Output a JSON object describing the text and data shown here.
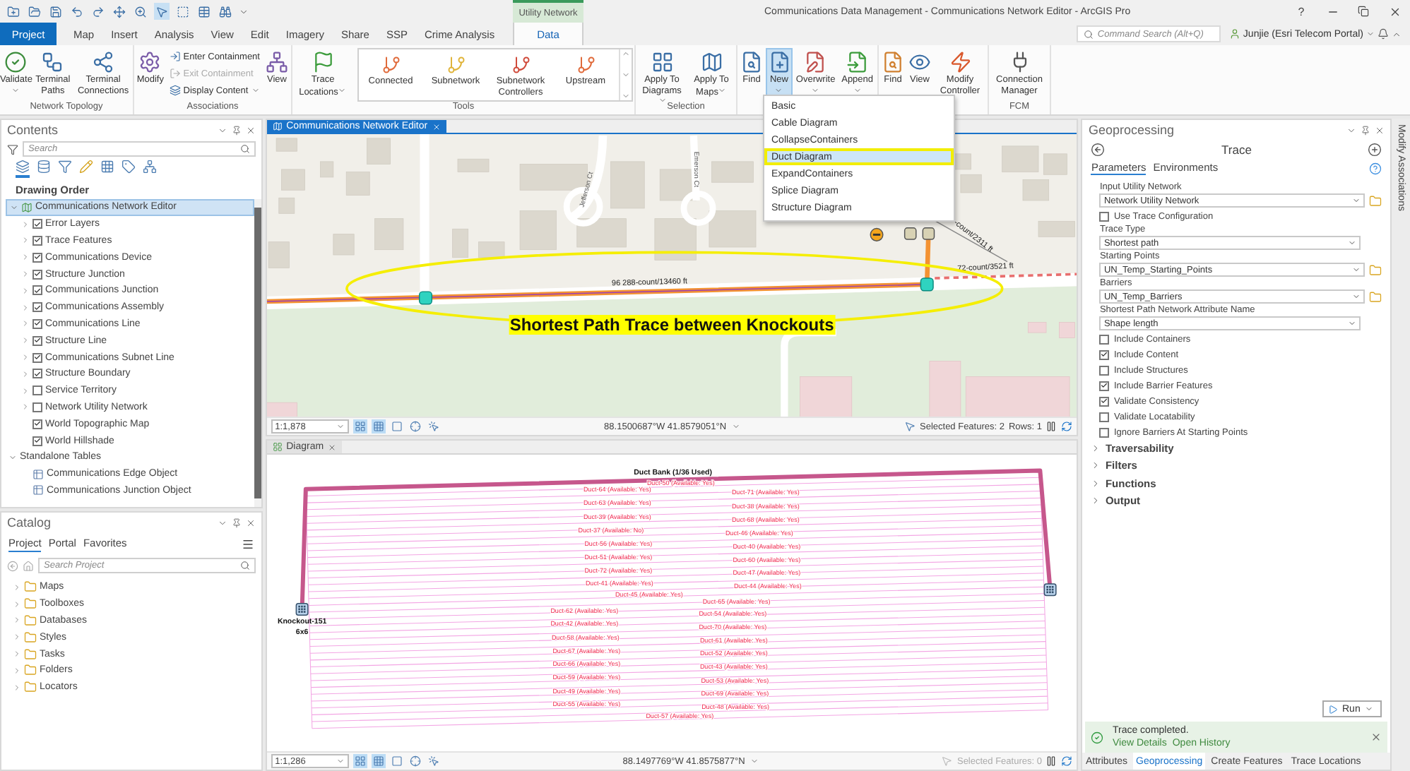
{
  "title_bar": {
    "title": "Communications Data Management - Communications Network Editor - ArcGIS Pro",
    "contextual_group": "Utility Network",
    "help": "?"
  },
  "quick_access": [
    {
      "on": false
    },
    {
      "on": false
    },
    {
      "on": false
    },
    {
      "on": false
    },
    {
      "on": false
    },
    {
      "on": false
    },
    {
      "on": false
    },
    {
      "on": true
    },
    {
      "on": false
    },
    {
      "on": false
    },
    {
      "on": false
    }
  ],
  "ribbon_tabs": [
    {
      "label": "Project",
      "kind": "backstage",
      "selected": false
    },
    {
      "label": "Map",
      "kind": "tab",
      "selected": false
    },
    {
      "label": "Insert",
      "kind": "tab",
      "selected": false
    },
    {
      "label": "Analysis",
      "kind": "tab",
      "selected": false
    },
    {
      "label": "View",
      "kind": "tab",
      "selected": false
    },
    {
      "label": "Edit",
      "kind": "tab",
      "selected": false
    },
    {
      "label": "Imagery",
      "kind": "tab",
      "selected": false
    },
    {
      "label": "Share",
      "kind": "tab",
      "selected": false
    },
    {
      "label": "SSP",
      "kind": "tab",
      "selected": false
    },
    {
      "label": "Crime Analysis",
      "kind": "tab",
      "selected": false
    },
    {
      "label": "Data",
      "kind": "contextual",
      "selected": true
    }
  ],
  "command_search": {
    "placeholder": "Command Search (Alt+Q)"
  },
  "user": {
    "name": "Junjie (Esri Telecom Portal)"
  },
  "ribbon_groups": [
    {
      "label": "Network Topology",
      "kind": "buttons",
      "buttons": [
        {
          "label": "Validate",
          "kind": "large",
          "dropdown": true,
          "disabled": false,
          "pressed": false
        },
        {
          "label": "Terminal Paths",
          "kind": "large",
          "dropdown": false,
          "disabled": false,
          "pressed": false
        },
        {
          "label": "Terminal Connections",
          "kind": "large",
          "dropdown": false,
          "disabled": false,
          "pressed": false
        }
      ]
    },
    {
      "label": "Associations",
      "kind": "buttons",
      "buttons": [
        {
          "label": "Modify",
          "kind": "large",
          "dropdown": false,
          "disabled": false,
          "pressed": false
        },
        {
          "label": "Enter Containment",
          "kind": "small",
          "dropdown": false,
          "disabled": false,
          "pressed": false
        },
        {
          "label": "Exit Containment",
          "kind": "small",
          "dropdown": false,
          "disabled": true,
          "pressed": false
        },
        {
          "label": "Display Content",
          "kind": "small",
          "dropdown": true,
          "disabled": false,
          "pressed": false
        },
        {
          "label": "View",
          "kind": "large",
          "dropdown": false,
          "disabled": false,
          "pressed": false
        }
      ]
    },
    {
      "label": "Tools",
      "kind": "gallery",
      "buttons": [
        {
          "label": "Trace Locations",
          "kind": "large",
          "dropdown": true,
          "disabled": false,
          "pressed": false
        }
      ],
      "gallery": [
        {
          "label": "Connected"
        },
        {
          "label": "Subnetwork"
        },
        {
          "label": "Subnetwork Controllers"
        },
        {
          "label": "Upstream"
        }
      ]
    },
    {
      "label": "Selection",
      "kind": "buttons",
      "buttons": [
        {
          "label": "Apply To Diagrams",
          "kind": "large",
          "dropdown": true,
          "disabled": false,
          "pressed": false
        },
        {
          "label": "Apply To Maps",
          "kind": "large",
          "dropdown": true,
          "disabled": false,
          "pressed": false
        }
      ]
    },
    {
      "kind": "buttons",
      "buttons": [
        {
          "label": "Find",
          "kind": "large",
          "dropdown": false,
          "disabled": false,
          "pressed": false
        },
        {
          "label": "New",
          "kind": "large",
          "dropdown": true,
          "disabled": false,
          "pressed": true
        },
        {
          "label": "Overwrite",
          "kind": "large",
          "dropdown": true,
          "disabled": false,
          "pressed": false
        },
        {
          "label": "Append",
          "kind": "large",
          "dropdown": true,
          "disabled": false,
          "pressed": false
        }
      ]
    },
    {
      "kind": "buttons",
      "buttons": [
        {
          "label": "Find",
          "kind": "large",
          "dropdown": false,
          "disabled": false,
          "pressed": false
        },
        {
          "label": "View",
          "kind": "large",
          "dropdown": false,
          "disabled": false,
          "pressed": false
        },
        {
          "label": "Modify Controller",
          "kind": "large",
          "dropdown": false,
          "disabled": false,
          "pressed": false
        }
      ]
    },
    {
      "label": "FCM",
      "kind": "buttons",
      "buttons": [
        {
          "label": "Connection Manager",
          "kind": "large",
          "dropdown": false,
          "disabled": false,
          "pressed": false
        }
      ]
    }
  ],
  "new_menu": {
    "items": [
      {
        "label": "Basic",
        "selected": false
      },
      {
        "label": "Cable Diagram",
        "selected": false
      },
      {
        "label": "CollapseContainers",
        "selected": false
      },
      {
        "label": "Duct Diagram",
        "selected": true
      },
      {
        "label": "ExpandContainers",
        "selected": false
      },
      {
        "label": "Splice Diagram",
        "selected": false
      },
      {
        "label": "Structure Diagram",
        "selected": false
      }
    ]
  },
  "contents": {
    "title": "Contents",
    "search_placeholder": "Search",
    "view_buttons": [
      {
        "selected": true
      },
      {
        "selected": false
      },
      {
        "selected": false
      },
      {
        "selected": false
      },
      {
        "selected": false
      },
      {
        "selected": false
      },
      {
        "selected": false
      }
    ],
    "heading": "Drawing Order",
    "tree": [
      {
        "label": "Communications Network Editor",
        "kind": "map",
        "selected": true,
        "expanded": true,
        "children": [
          {
            "label": "Error Layers",
            "kind": "layer",
            "selected": false,
            "expandable": true,
            "checked": true
          },
          {
            "label": "Trace Features",
            "kind": "layer",
            "selected": false,
            "expandable": true,
            "checked": true
          },
          {
            "label": "Communications Device",
            "kind": "layer",
            "selected": false,
            "expandable": true,
            "checked": true
          },
          {
            "label": "Structure Junction",
            "kind": "layer",
            "selected": false,
            "expandable": true,
            "checked": true
          },
          {
            "label": "Communications Junction",
            "kind": "layer",
            "selected": false,
            "expandable": true,
            "checked": true
          },
          {
            "label": "Communications Assembly",
            "kind": "layer",
            "selected": false,
            "expandable": true,
            "checked": true
          },
          {
            "label": "Communications Line",
            "kind": "layer",
            "selected": false,
            "expandable": true,
            "checked": true
          },
          {
            "label": "Structure Line",
            "kind": "layer",
            "selected": false,
            "expandable": true,
            "checked": true
          },
          {
            "label": "Communications Subnet Line",
            "kind": "layer",
            "selected": false,
            "expandable": true,
            "checked": true
          },
          {
            "label": "Structure Boundary",
            "kind": "layer",
            "selected": false,
            "expandable": true,
            "checked": true
          },
          {
            "label": "Service Territory",
            "kind": "layer",
            "selected": false,
            "expandable": true,
            "checked": false
          },
          {
            "label": "Network Utility Network",
            "kind": "layer",
            "selected": false,
            "expandable": true,
            "checked": false
          },
          {
            "label": "World Topographic Map",
            "kind": "layer",
            "selected": false,
            "expandable": false,
            "checked": true
          },
          {
            "label": "World Hillshade",
            "kind": "layer",
            "selected": false,
            "expandable": false,
            "checked": true
          }
        ]
      },
      {
        "label": "Standalone Tables",
        "kind": "group",
        "selected": false,
        "expanded": true,
        "children": [
          {
            "label": "Communications Edge Object",
            "kind": "table",
            "selected": false
          },
          {
            "label": "Communications Junction Object",
            "kind": "table",
            "selected": false
          }
        ]
      }
    ]
  },
  "catalog": {
    "title": "Catalog",
    "tabs": [
      {
        "label": "Project",
        "selected": true
      },
      {
        "label": "Portal",
        "selected": false
      },
      {
        "label": "Favorites",
        "selected": false
      }
    ],
    "search_placeholder": "Search Project",
    "items": [
      {
        "label": "Maps"
      },
      {
        "label": "Toolboxes"
      },
      {
        "label": "Databases"
      },
      {
        "label": "Styles"
      },
      {
        "label": "Tasks"
      },
      {
        "label": "Folders"
      },
      {
        "label": "Locators"
      }
    ]
  },
  "map_view": {
    "tab": {
      "label": "Communications Network Editor",
      "selected": true
    },
    "street_labels": [
      "Jefferson Ct",
      "Emerson Ct"
    ],
    "line_labels": [
      "96 288-count/13460 ft",
      "-count/2311 ft",
      "72-count/3521 ft"
    ],
    "annotation": "Shortest Path Trace between Knockouts",
    "status": {
      "scale": "1:1,878",
      "toggles": [
        {
          "on": true
        },
        {
          "on": true
        },
        {
          "on": false
        },
        {
          "on": false
        },
        {
          "on": false
        }
      ],
      "coordinates": "88.1500687°W 41.8579051°N",
      "selected_features": {
        "text": "Selected Features: 2",
        "disabled": false
      },
      "rows": "Rows: 1"
    }
  },
  "diagram_view": {
    "tab": {
      "label": "Diagram",
      "selected": false
    },
    "title": "Duct Bank (1/36 Used)",
    "knockout": {
      "name": "Knockout-151",
      "size": "6x6"
    },
    "ducts": [
      "Duct-50 (Available: Yes)",
      "Duct-64 (Available: Yes)",
      "Duct-63 (Available: Yes)",
      "Duct-39 (Available: Yes)",
      "Duct-37 (Available: No)",
      "Duct-56 (Available: Yes)",
      "Duct-51 (Available: Yes)",
      "Duct-72 (Available: Yes)",
      "Duct-41 (Available: Yes)",
      "Duct-71 (Available: Yes)",
      "Duct-38 (Available: Yes)",
      "Duct-68 (Available: Yes)",
      "Duct-46 (Available: Yes)",
      "Duct-40 (Available: Yes)",
      "Duct-60 (Available: Yes)",
      "Duct-47 (Available: Yes)",
      "Duct-44 (Available: Yes)",
      "Duct-45 (Available: Yes)",
      "Duct-65 (Available: Yes)",
      "Duct-54 (Available: Yes)",
      "Duct-70 (Available: Yes)",
      "Duct-61 (Available: Yes)",
      "Duct-52 (Available: Yes)",
      "Duct-43 (Available: Yes)",
      "Duct-53 (Available: Yes)",
      "Duct-69 (Available: Yes)",
      "Duct-48 (Available: Yes)",
      "Duct-62 (Available: Yes)",
      "Duct-42 (Available: Yes)",
      "Duct-58 (Available: Yes)",
      "Duct-67 (Available: Yes)",
      "Duct-66 (Available: Yes)",
      "Duct-59 (Available: Yes)",
      "Duct-49 (Available: Yes)",
      "Duct-55 (Available: Yes)",
      "Duct-57 (Available: Yes)"
    ],
    "status": {
      "scale": "1:1,286",
      "toggles": [
        {
          "on": true
        },
        {
          "on": true
        },
        {
          "on": false
        },
        {
          "on": false
        },
        {
          "on": false
        }
      ],
      "coordinates": "88.1497769°W 41.8575877°N",
      "selected_features": {
        "text": "Selected Features: 0",
        "disabled": true
      }
    }
  },
  "geoprocessing": {
    "title": "Geoprocessing",
    "tool": "Trace",
    "tabs": [
      {
        "label": "Parameters",
        "selected": true
      },
      {
        "label": "Environments",
        "selected": false
      }
    ],
    "params": [
      {
        "kind": "select",
        "label": "Input Utility Network",
        "value": "Network Utility Network",
        "browse": true
      },
      {
        "kind": "checkbox",
        "label": "Use Trace Configuration",
        "checked": false
      },
      {
        "kind": "select",
        "label": "Trace Type",
        "value": "Shortest path",
        "browse": false
      },
      {
        "kind": "select",
        "label": "Starting Points",
        "value": "UN_Temp_Starting_Points",
        "browse": true
      },
      {
        "kind": "select",
        "label": "Barriers",
        "value": "UN_Temp_Barriers",
        "browse": true
      },
      {
        "kind": "select",
        "label": "Shortest Path Network Attribute Name",
        "value": "Shape length",
        "browse": false
      },
      {
        "kind": "checkbox",
        "label": "Include Containers",
        "checked": false
      },
      {
        "kind": "checkbox",
        "label": "Include Content",
        "checked": true
      },
      {
        "kind": "checkbox",
        "label": "Include Structures",
        "checked": false
      },
      {
        "kind": "checkbox",
        "label": "Include Barrier Features",
        "checked": true
      },
      {
        "kind": "checkbox",
        "label": "Validate Consistency",
        "checked": true
      },
      {
        "kind": "checkbox",
        "label": "Validate Locatability",
        "checked": false
      },
      {
        "kind": "checkbox",
        "label": "Ignore Barriers At Starting Points",
        "checked": false
      }
    ],
    "sections": [
      {
        "label": "Traversability",
        "expanded": false
      },
      {
        "label": "Filters",
        "expanded": false
      },
      {
        "label": "Functions",
        "expanded": false
      },
      {
        "label": "Output",
        "expanded": false
      }
    ],
    "run": "Run",
    "message": {
      "text": "Trace completed.",
      "links": [
        "View Details",
        "Open History"
      ]
    },
    "bottom_tabs": [
      {
        "label": "Attributes",
        "selected": false
      },
      {
        "label": "Geoprocessing",
        "selected": true
      },
      {
        "label": "Create Features",
        "selected": false
      },
      {
        "label": "Trace Locations",
        "selected": false
      }
    ]
  },
  "side_tab": {
    "label": "Modify Associations"
  }
}
